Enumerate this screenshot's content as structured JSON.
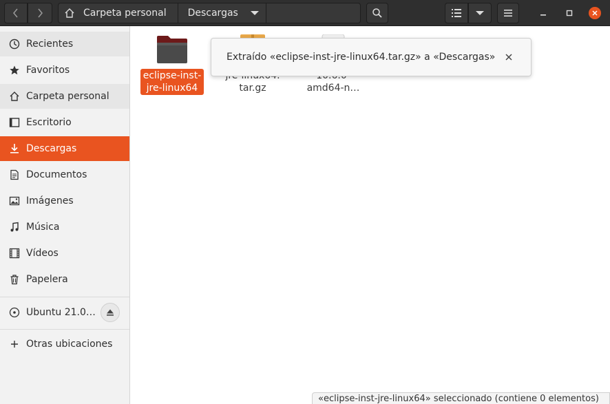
{
  "header": {
    "path": [
      {
        "label": "Carpeta personal"
      },
      {
        "label": "Descargas"
      }
    ]
  },
  "sidebar": {
    "items": [
      {
        "label": "Recientes",
        "icon": "clock-icon"
      },
      {
        "label": "Favoritos",
        "icon": "star-icon"
      },
      {
        "label": "Carpeta personal",
        "icon": "home-icon"
      },
      {
        "label": "Escritorio",
        "icon": "desktop-icon"
      },
      {
        "label": "Descargas",
        "icon": "download-icon"
      },
      {
        "label": "Documentos",
        "icon": "document-icon"
      },
      {
        "label": "Imágenes",
        "icon": "image-icon"
      },
      {
        "label": "Música",
        "icon": "music-icon"
      },
      {
        "label": "Vídeos",
        "icon": "video-icon"
      },
      {
        "label": "Papelera",
        "icon": "trash-icon"
      }
    ],
    "devices": [
      {
        "label": "Ubuntu 21.0…",
        "icon": "disk-icon"
      }
    ],
    "other": {
      "label": "Otras ubicaciones",
      "icon": "plus-icon"
    }
  },
  "files": [
    {
      "name_line1": "eclipse-inst-",
      "name_line2": "jre-linux64",
      "name_line3": "",
      "type": "folder"
    },
    {
      "name_line1": "",
      "name_line2": "jre-linux64.",
      "name_line3": "tar.gz",
      "type": "archive"
    },
    {
      "name_line1": "",
      "name_line2": "10.6.0-",
      "name_line3": "amd64-n…",
      "type": "package"
    }
  ],
  "notification": {
    "text": "Extraído «eclipse-inst-jre-linux64.tar.gz» a «Descargas»"
  },
  "status": {
    "text": "«eclipse-inst-jre-linux64» seleccionado  (contiene 0 elementos)"
  },
  "colors": {
    "accent": "#e95420",
    "header": "#2f2f2f"
  }
}
